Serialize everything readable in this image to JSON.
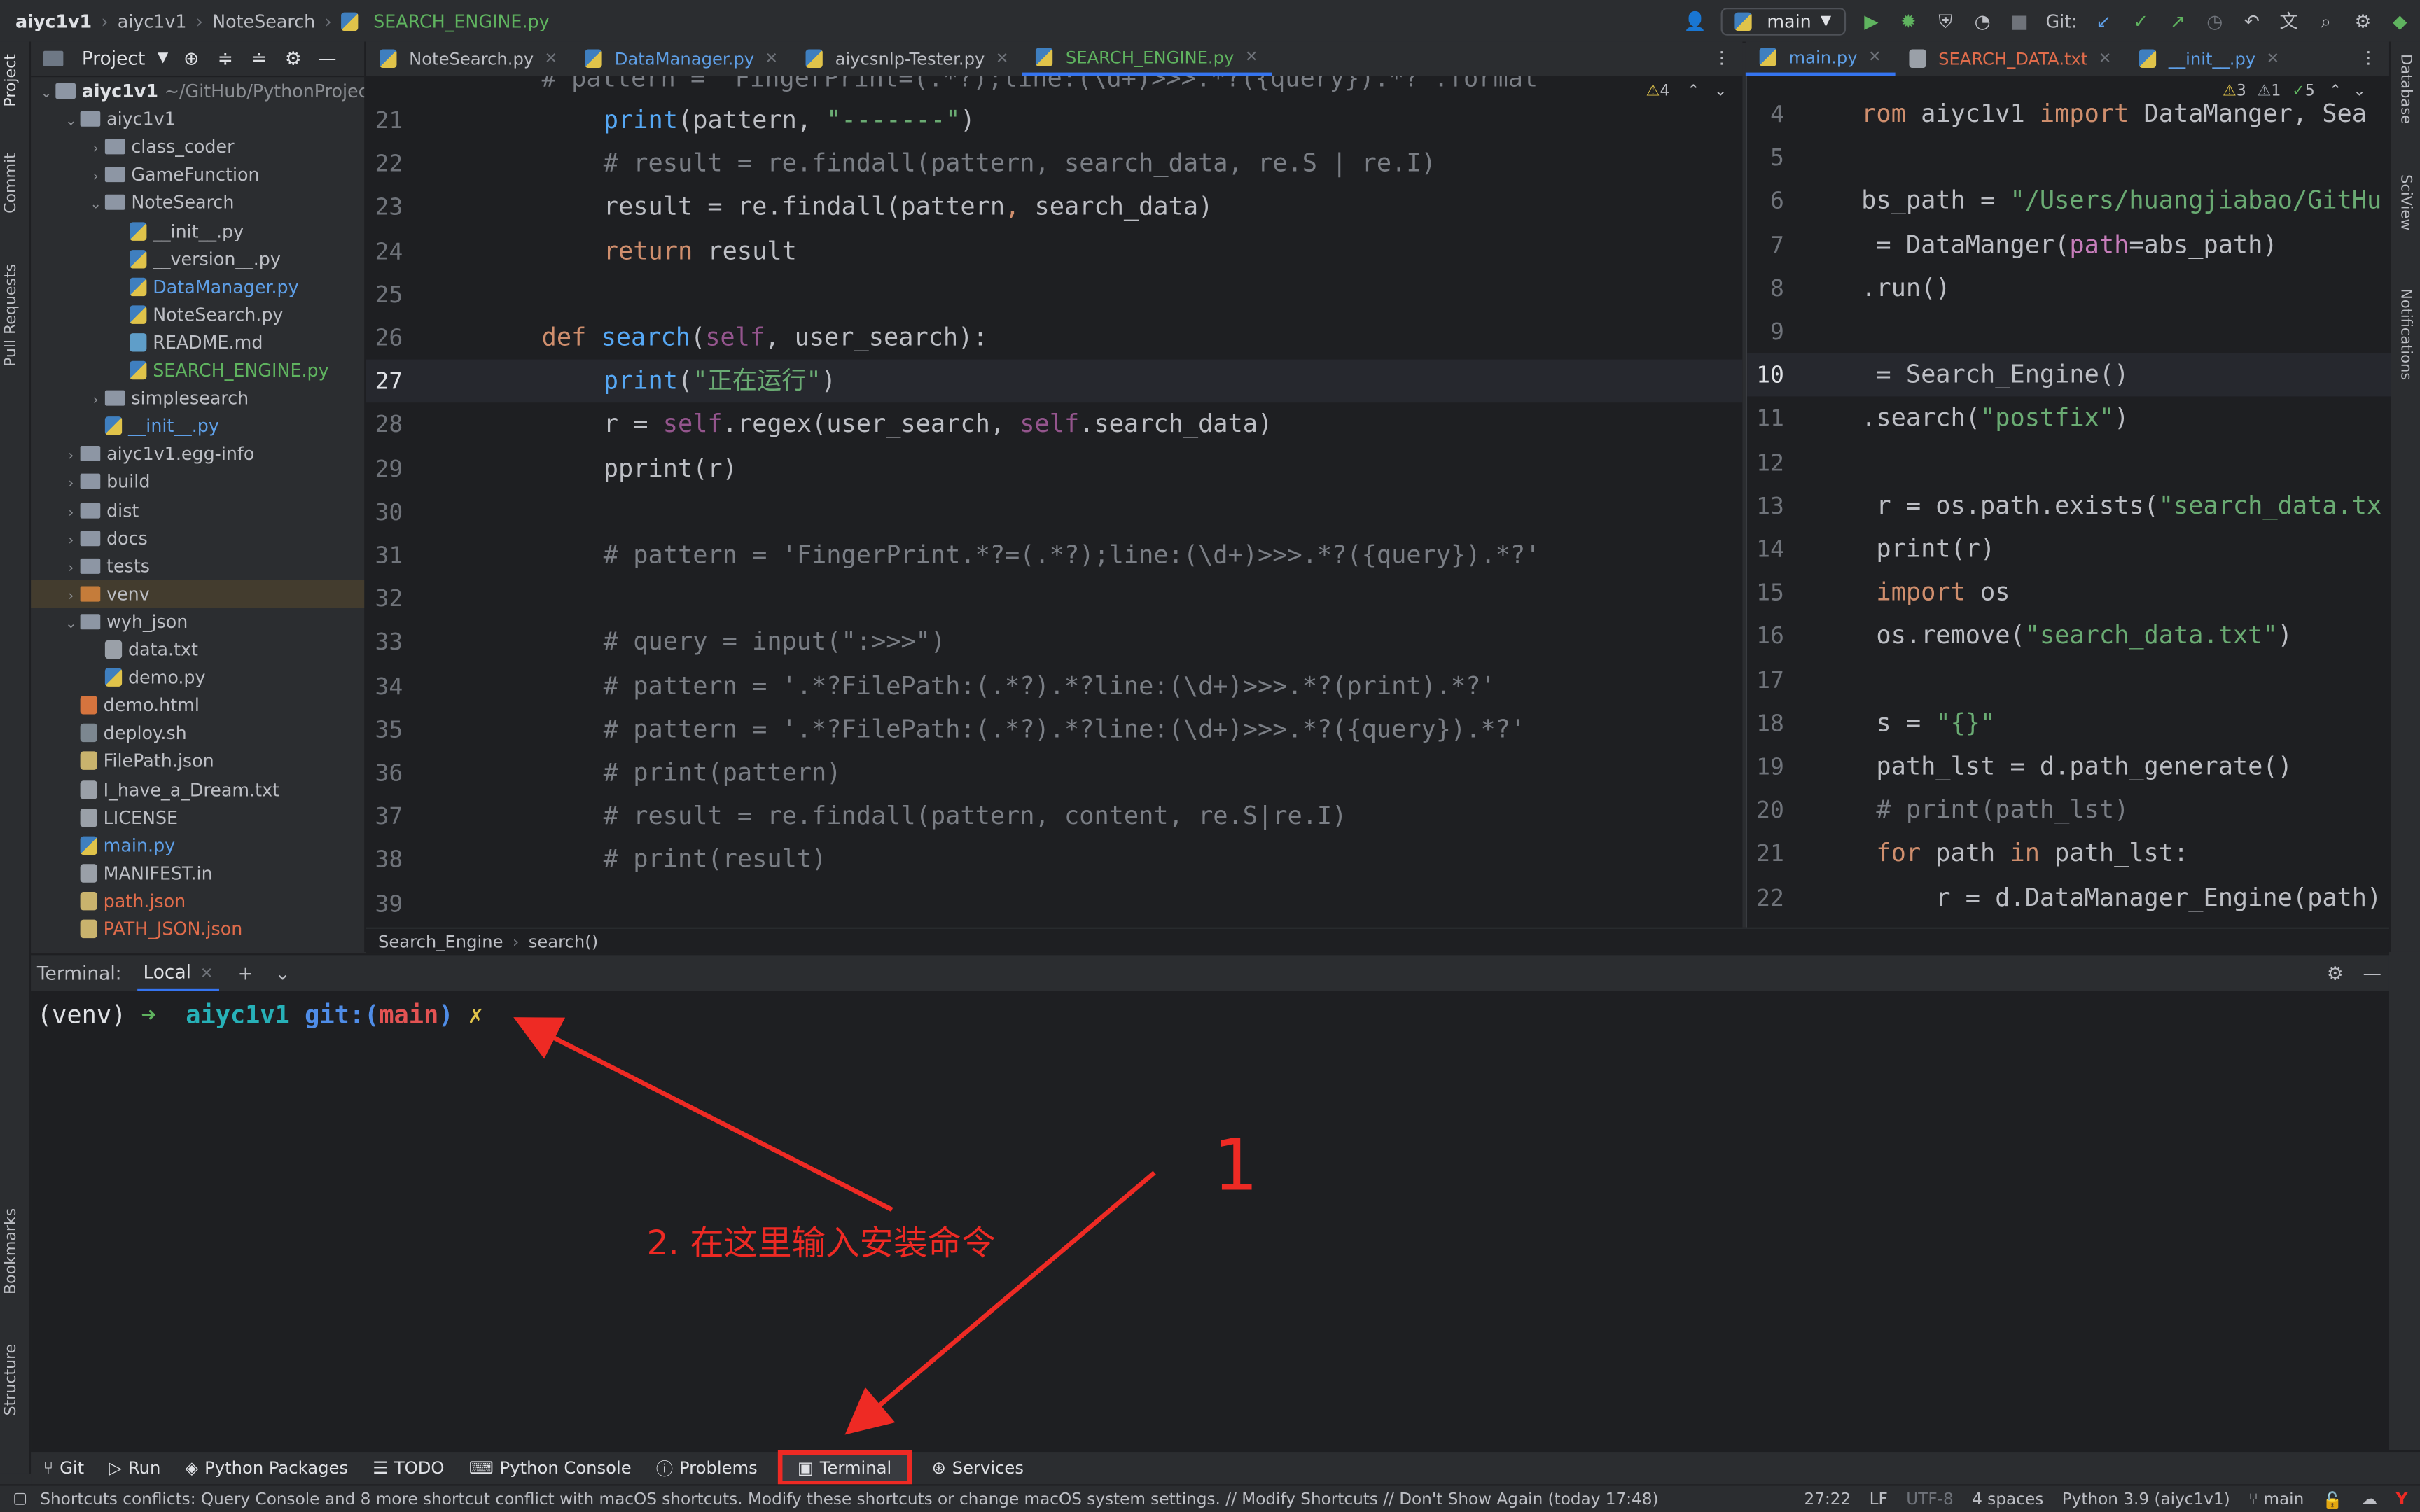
{
  "titlebar": {
    "breadcrumbs": [
      "aiyc1v1",
      "aiyc1v1",
      "NoteSearch",
      "SEARCH_ENGINE.py"
    ],
    "branch": "main",
    "git_label": "Git:"
  },
  "left_strip": {
    "items": [
      "Project",
      "Commit",
      "Pull Requests",
      "Bookmarks",
      "Structure"
    ]
  },
  "right_strip": {
    "items": [
      "Database",
      "SciView",
      "Notifications"
    ]
  },
  "project": {
    "title": "Project",
    "tree": [
      {
        "label": "aiyc1v1",
        "suffix": "~/GitHub/PythonProject",
        "type": "folder",
        "depth": 0,
        "open": true,
        "bold": true
      },
      {
        "label": "aiyc1v1",
        "type": "folder",
        "depth": 1,
        "open": true
      },
      {
        "label": "class_coder",
        "type": "folder",
        "depth": 2,
        "open": false
      },
      {
        "label": "GameFunction",
        "type": "folder",
        "depth": 2,
        "open": false
      },
      {
        "label": "NoteSearch",
        "type": "folder",
        "depth": 2,
        "open": true
      },
      {
        "label": "__init__.py",
        "type": "py",
        "depth": 3
      },
      {
        "label": "__version__.py",
        "type": "py",
        "depth": 3
      },
      {
        "label": "DataManager.py",
        "type": "py",
        "depth": 3,
        "color": "#5e9fe7"
      },
      {
        "label": "NoteSearch.py",
        "type": "py",
        "depth": 3
      },
      {
        "label": "README.md",
        "type": "md",
        "depth": 3
      },
      {
        "label": "SEARCH_ENGINE.py",
        "type": "py",
        "depth": 3,
        "color": "#5fb35f"
      },
      {
        "label": "simplesearch",
        "type": "folder",
        "depth": 2,
        "open": false
      },
      {
        "label": "__init__.py",
        "type": "py",
        "depth": 2,
        "color": "#5e9fe7"
      },
      {
        "label": "aiyc1v1.egg-info",
        "type": "folder",
        "depth": 1,
        "open": false
      },
      {
        "label": "build",
        "type": "folder",
        "depth": 1,
        "open": false
      },
      {
        "label": "dist",
        "type": "folder",
        "depth": 1,
        "open": false
      },
      {
        "label": "docs",
        "type": "folder",
        "depth": 1,
        "open": false
      },
      {
        "label": "tests",
        "type": "folder",
        "depth": 1,
        "open": false
      },
      {
        "label": "venv",
        "type": "folder-orange",
        "depth": 1,
        "open": false,
        "highlight": true
      },
      {
        "label": "wyh_json",
        "type": "folder",
        "depth": 1,
        "open": true
      },
      {
        "label": "data.txt",
        "type": "txt",
        "depth": 2
      },
      {
        "label": "demo.py",
        "type": "py",
        "depth": 2
      },
      {
        "label": "demo.html",
        "type": "html",
        "depth": 1
      },
      {
        "label": "deploy.sh",
        "type": "sh",
        "depth": 1
      },
      {
        "label": "FilePath.json",
        "type": "json",
        "depth": 1
      },
      {
        "label": "I_have_a_Dream.txt",
        "type": "txt",
        "depth": 1
      },
      {
        "label": "LICENSE",
        "type": "txt",
        "depth": 1
      },
      {
        "label": "main.py",
        "type": "py",
        "depth": 1,
        "color": "#5e9fe7"
      },
      {
        "label": "MANIFEST.in",
        "type": "txt",
        "depth": 1
      },
      {
        "label": "path.json",
        "type": "json",
        "depth": 1,
        "color": "#e06c4b"
      },
      {
        "label": "PATH_JSON.json",
        "type": "json",
        "depth": 1,
        "color": "#e06c4b"
      }
    ]
  },
  "editor_tabs": [
    {
      "label": "NoteSearch.py",
      "color": "#bcbec4",
      "active": false
    },
    {
      "label": "DataManager.py",
      "color": "#5e9fe7",
      "active": false
    },
    {
      "label": "aiycsnlp-Tester.py",
      "color": "#bcbec4",
      "active": false
    },
    {
      "label": "SEARCH_ENGINE.py",
      "color": "#5fb35f",
      "active": true
    }
  ],
  "right_tabs": [
    {
      "label": "main.py",
      "color": "#5e9fe7",
      "active": true
    },
    {
      "label": "SEARCH_DATA.txt",
      "color": "#e06c4b",
      "active": false
    },
    {
      "label": "__init__.py",
      "color": "#5e9fe7",
      "active": false
    }
  ],
  "inspection": {
    "warnings": "4",
    "r_warn": "3",
    "r_weak": "1",
    "r_ok": "5"
  },
  "editor": {
    "line_numbers": [
      "21",
      "22",
      "23",
      "24",
      "25",
      "26",
      "27",
      "28",
      "29",
      "30",
      "31",
      "32",
      "33",
      "34",
      "35",
      "36",
      "37",
      "38",
      "39"
    ],
    "top_partial": "# pattern = 'FingerPrint=(.*?);line:(\\d+)>>>.*?({query}).*?'.format"
  },
  "editor_lines": {
    "l21": {
      "fn": "print",
      "a": "(pattern, ",
      "s": "\"-------\"",
      "b": ")"
    },
    "l22": "# result = re.findall(pattern, search_data, re.S | re.I)",
    "l23": {
      "a": "result = re.findall(pattern",
      "c": ", ",
      "b": "search_data)"
    },
    "l24": {
      "kw": "return",
      "a": " result"
    },
    "l26": {
      "kw": "def ",
      "fn": "search",
      "a": "(",
      "self": "self",
      "b": ", user_search):"
    },
    "l27": {
      "fn": "print",
      "a": "(",
      "s": "\"正在运行\"",
      "b": ")"
    },
    "l28": {
      "a": "r = ",
      "self": "self",
      "b": ".regex(user_search, ",
      "self2": "self",
      "c": ".search_data)"
    },
    "l29": "pprint(r)",
    "l31": "# pattern = 'FingerPrint.*?=(.*?);line:(\\d+)>>>.*?({query}).*?'",
    "l33": "# query = input(\":>>>\")",
    "l34": "# pattern = '.*?FilePath:(.*?).*?line:(\\d+)>>>.*?(print).*?'",
    "l35": "# pattern = '.*?FilePath:(.*?).*?line:(\\d+)>>>.*?({query}).*?'",
    "l36": "# print(pattern)",
    "l37": "# result = re.findall(pattern, content, re.S|re.I)",
    "l38": "# print(result)"
  },
  "editor2": {
    "line_numbers": [
      "4",
      "5",
      "6",
      "7",
      "8",
      "9",
      "10",
      "11",
      "12",
      "13",
      "14",
      "15",
      "16",
      "17",
      "18",
      "19",
      "20",
      "21",
      "22"
    ],
    "l4": {
      "kw": "rom ",
      "a": "aiyc1v1 ",
      "kw2": "import",
      "b": " DataManger, Sea"
    },
    "l6": {
      "a": "bs_path = ",
      "s": "\"/Users/huangjiabao/GitHu"
    },
    "l7": {
      "a": " = DataManger(",
      "p": "path",
      "b": "=abs_path)"
    },
    "l8": ".run()",
    "l10": " = Search_Engine()",
    "l11": {
      "a": ".search(",
      "s": "\"postfix\"",
      "b": ")"
    },
    "l13": {
      "a": " r = os.path.exists(",
      "s": "\"search_data.tx"
    },
    "l14": " print(r)",
    "l15": {
      "kw": " import",
      "a": " os"
    },
    "l16": {
      "a": " os.remove(",
      "s": "\"search_data.txt\"",
      "b": ")"
    },
    "l18": {
      "a": " s = ",
      "s": "\"{}\""
    },
    "l19": " path_lst = d.path_generate()",
    "l20": " # print(path_lst)",
    "l21": {
      "kw": " for",
      "a": " path ",
      "kw2": "in",
      "b": " path_lst:"
    },
    "l22": "     r = d.DataManager_Engine(path)"
  },
  "editor_breadcrumb": [
    "Search_Engine",
    "search()"
  ],
  "terminal": {
    "label": "Terminal:",
    "tab": "Local",
    "prompt_env": "(venv)",
    "prompt_arrow": "➜",
    "prompt_dir": "aiyc1v1",
    "prompt_git": "git:(",
    "prompt_branch": "main",
    "prompt_git_end": ")",
    "prompt_x": "✗"
  },
  "annotations": {
    "number": "1",
    "text": "2. 在这里输入安装命令",
    "color": "#ee2a24"
  },
  "bottom_tools": [
    {
      "label": "Git",
      "icon": "git-icon"
    },
    {
      "label": "Run",
      "icon": "run-icon"
    },
    {
      "label": "Python Packages",
      "icon": "packages-icon"
    },
    {
      "label": "TODO",
      "icon": "todo-icon"
    },
    {
      "label": "Python Console",
      "icon": "console-icon"
    },
    {
      "label": "Problems",
      "icon": "problems-icon"
    },
    {
      "label": "Terminal",
      "icon": "terminal-icon",
      "highlighted": true
    },
    {
      "label": "Services",
      "icon": "services-icon"
    }
  ],
  "status": {
    "message": "Shortcuts conflicts: Query Console and 8 more shortcut conflict with macOS shortcuts. Modify these shortcuts or change macOS system settings. // Modify Shortcuts // Don't Show Again (today 17:48)",
    "position": "27:22",
    "line_sep": "LF",
    "encoding": "UTF-8",
    "indent": "4 spaces",
    "interpreter": "Python 3.9 (aiyc1v1)",
    "branch": "main"
  }
}
